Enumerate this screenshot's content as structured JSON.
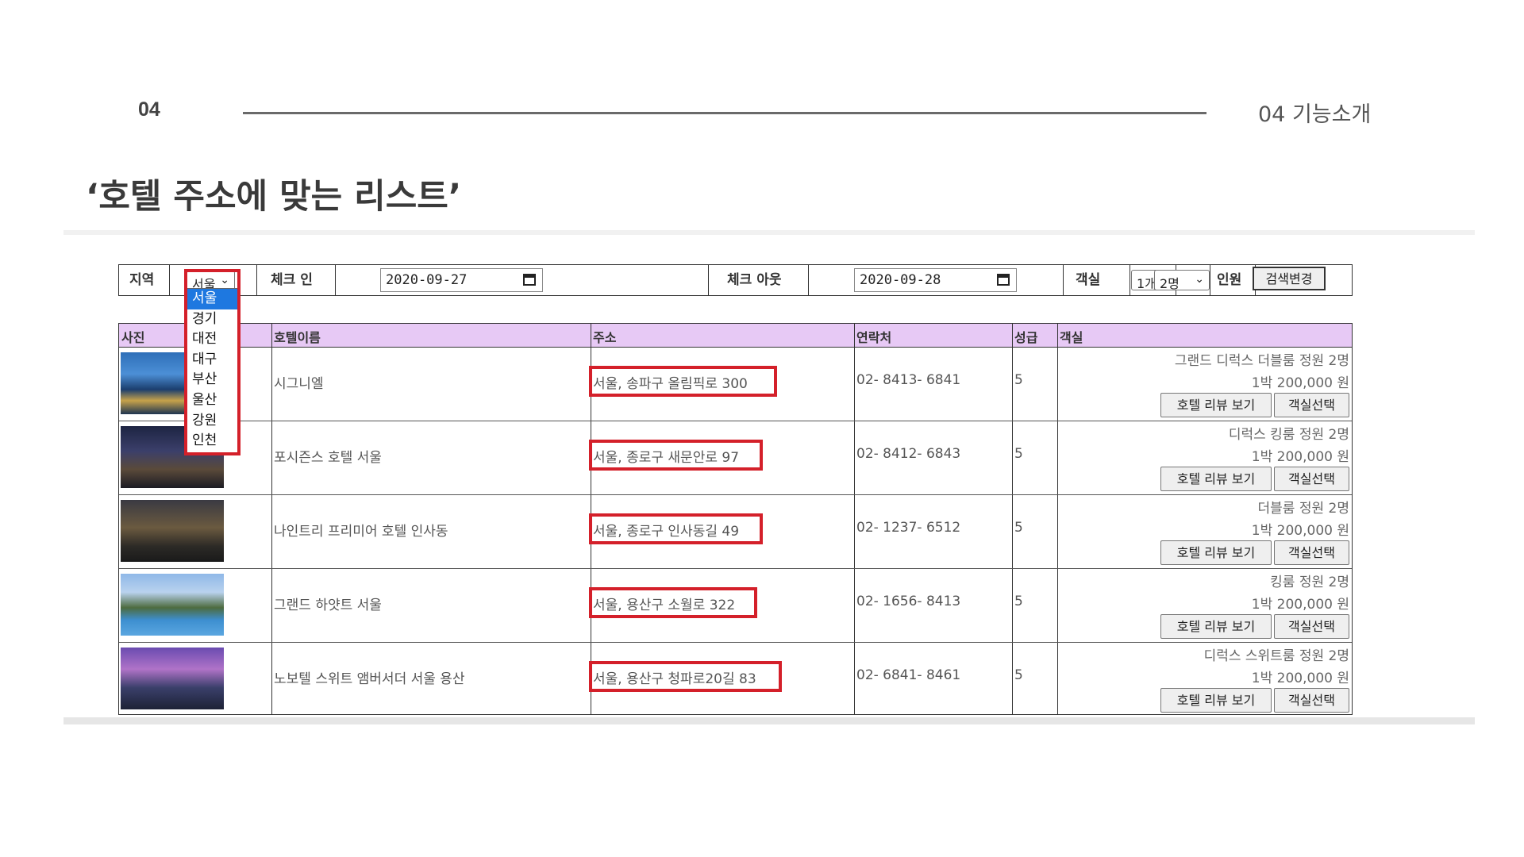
{
  "slide": {
    "number": "04",
    "section": "04 기능소개",
    "title": "‘호텔 주소에 맞는 리스트’"
  },
  "search": {
    "region_label": "지역",
    "region_value": "서울",
    "checkin_label": "체크 인",
    "checkin_value": "2020-09-27",
    "checkout_label": "체크 아웃",
    "checkout_value": "2020-09-28",
    "rooms_label": "객실",
    "rooms_value": "1개",
    "people_label": "인원",
    "people_value": "2명",
    "submit_label": "검색변경"
  },
  "region_options": [
    "서울",
    "경기",
    "대전",
    "대구",
    "부산",
    "울산",
    "강원",
    "인천"
  ],
  "table": {
    "headers": {
      "photo": "사진",
      "name": "호텔이름",
      "address": "주소",
      "contact": "연락처",
      "grade": "성급",
      "room": "객실"
    },
    "review_button": "호텔 리뷰 보기",
    "select_button": "객실선택",
    "rows": [
      {
        "name": "시그니엘",
        "address": "서울, 송파구 올림픽로 300",
        "contact": "02- 8413- 6841",
        "grade": "5",
        "room_type": "그랜드 디럭스 더블룸 정원 2명",
        "price": "1박 200,000 원",
        "photo": "city-night-tower"
      },
      {
        "name": "포시즌스 호텔 서울",
        "address": "서울, 종로구 새문안로 97",
        "contact": "02- 8412- 6843",
        "grade": "5",
        "room_type": "디럭스 킹룸 정원 2명",
        "price": "1박 200,000 원",
        "photo": "hotel-night-tower"
      },
      {
        "name": "나인트리 프리미어 호텔 인사동",
        "address": "서울, 종로구 인사동길 49",
        "contact": "02- 1237- 6512",
        "grade": "5",
        "room_type": "더블룸 정원 2명",
        "price": "1박 200,000 원",
        "photo": "city-dusk-aerial"
      },
      {
        "name": "그랜드 하얏트 서울",
        "address": "서울, 용산구 소월로 322",
        "contact": "02- 1656- 8413",
        "grade": "5",
        "room_type": "킹룸 정원 2명",
        "price": "1박 200,000 원",
        "photo": "outdoor-pool"
      },
      {
        "name": "노보텔 스위트 앰버서더 서울 용산",
        "address": "서울, 용산구 청파로20길 83",
        "contact": "02- 6841- 8461",
        "grade": "5",
        "room_type": "디럭스 스위트룸 정원 2명",
        "price": "1박 200,000 원",
        "photo": "twilight-towers"
      }
    ]
  },
  "colors": {
    "header_bg": "#e7c9f5",
    "highlight_red": "#d4202a",
    "selected_option": "#1e78e0"
  }
}
